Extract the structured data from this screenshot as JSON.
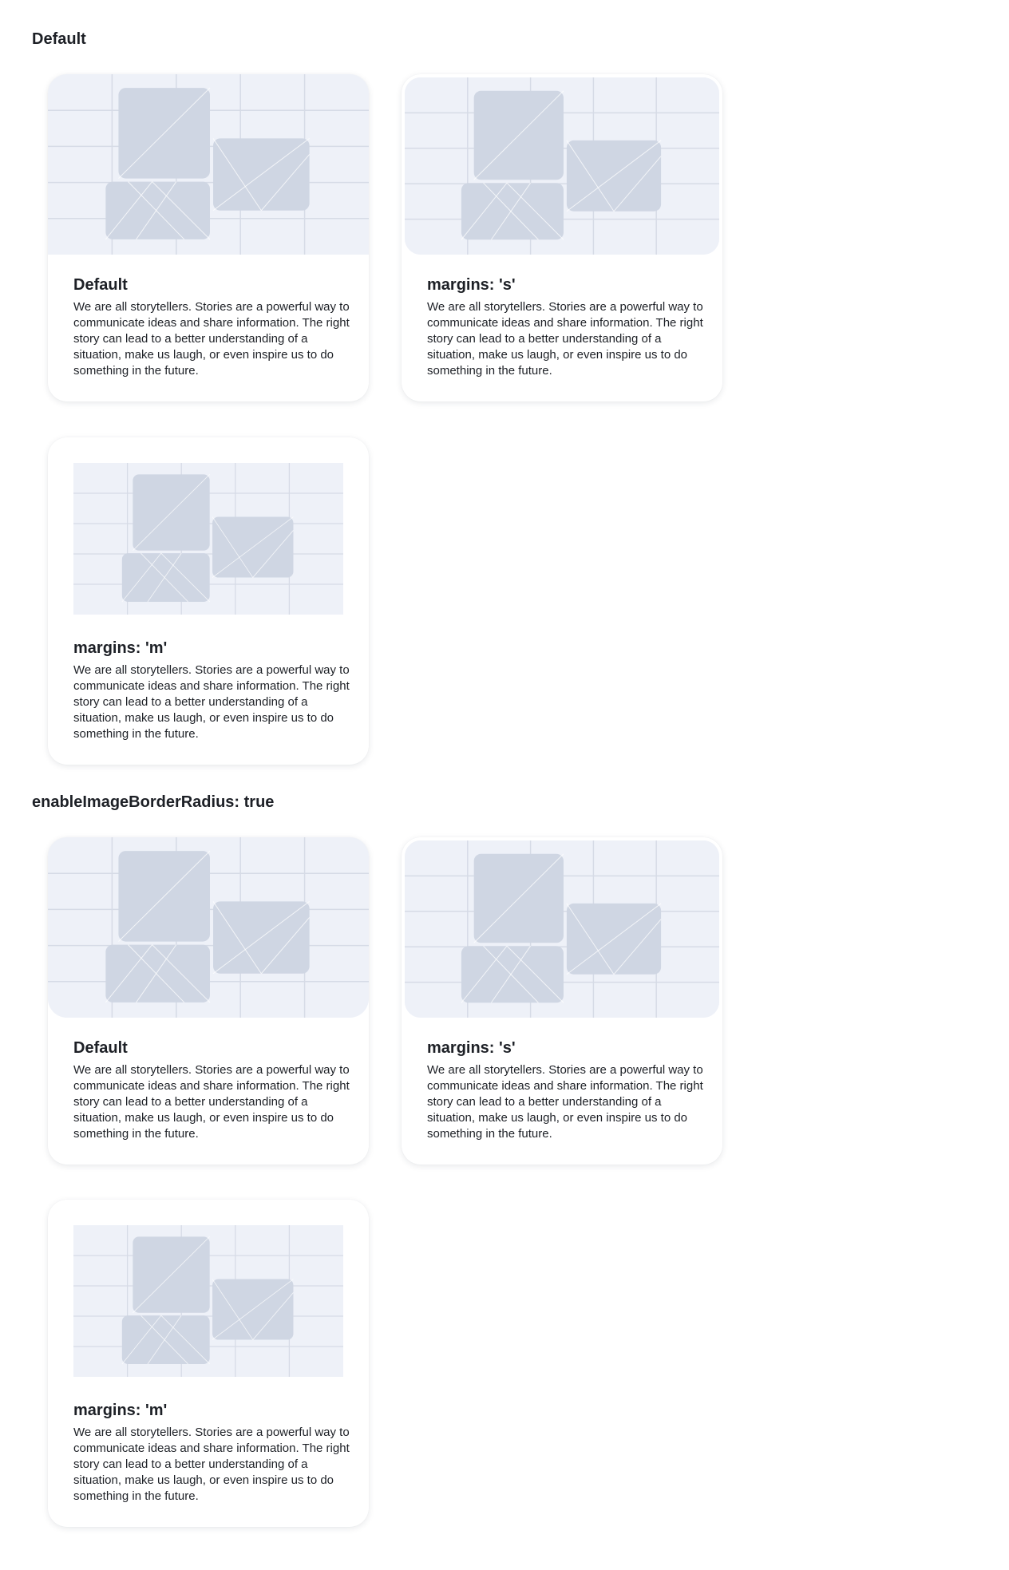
{
  "sections": [
    {
      "title": "Default",
      "cards": [
        {
          "title": "Default",
          "text": "We are all storytellers. Stories are a powerful way to communicate ideas and share information. The right story can lead to a better understanding of a situation, make us laugh, or even inspire us to do something in the future."
        },
        {
          "title": "margins: 's'",
          "text": "We are all storytellers. Stories are a powerful way to communicate ideas and share information. The right story can lead to a better understanding of a situation, make us laugh, or even inspire us to do something in the future."
        },
        {
          "title": "margins: 'm'",
          "text": "We are all storytellers. Stories are a powerful way to communicate ideas and share information. The right story can lead to a better understanding of a situation, make us laugh, or even inspire us to do something in the future."
        }
      ]
    },
    {
      "title": "enableImageBorderRadius: true",
      "cards": [
        {
          "title": "Default",
          "text": "We are all storytellers. Stories are a powerful way to communicate ideas and share information. The right story can lead to a better understanding of a situation, make us laugh, or even inspire us to do something in the future."
        },
        {
          "title": "margins: 's'",
          "text": "We are all storytellers. Stories are a powerful way to communicate ideas and share information. The right story can lead to a better understanding of a situation, make us laugh, or even inspire us to do something in the future."
        },
        {
          "title": "margins: 'm'",
          "text": "We are all storytellers. Stories are a powerful way to communicate ideas and share information. The right story can lead to a better understanding of a situation, make us laugh, or even inspire us to do something in the future."
        }
      ]
    }
  ],
  "colors": {
    "placeholder_bg": "#eef1f8",
    "placeholder_shape": "#cfd6e3",
    "placeholder_grid": "#d6dbe6"
  },
  "icons": {
    "media": "image-placeholder-icon"
  }
}
